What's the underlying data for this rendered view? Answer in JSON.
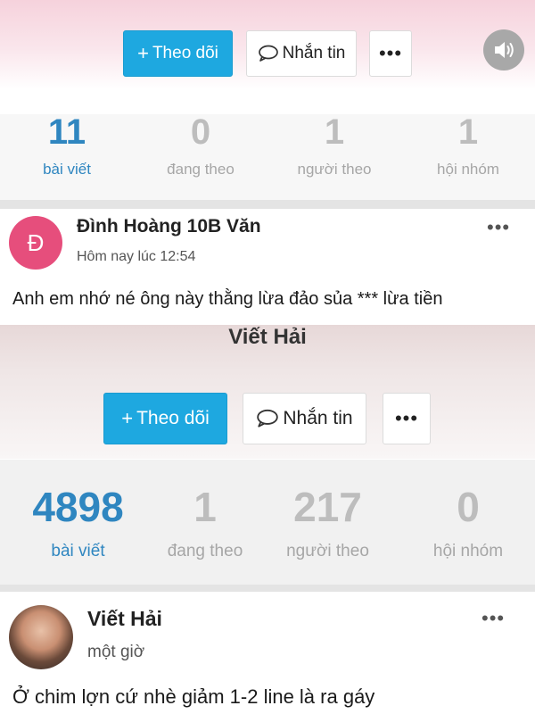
{
  "top_profile": {
    "follow_label": "+ Theo dõi",
    "follow_text": "Theo dõi",
    "message_label": "Nhắn tin",
    "more_label": "•••",
    "stats": [
      {
        "value": "11",
        "label": "bài viết"
      },
      {
        "value": "0",
        "label": "đang theo"
      },
      {
        "value": "1",
        "label": "người theo"
      },
      {
        "value": "1",
        "label": "hội nhóm"
      }
    ]
  },
  "post": {
    "author": "Đình Hoàng 10B Văn",
    "avatar_letter": "Đ",
    "time": "Hôm nay lúc 12:54",
    "more": "•••",
    "text": "Anh em nhớ né ông này thằng lừa đảo sủa *** lừa tiền"
  },
  "embedded_profile": {
    "name": "Viết Hải",
    "follow_text": "Theo dõi",
    "message_label": "Nhắn tin",
    "more_label": "•••",
    "stats": [
      {
        "value": "4898",
        "label": "bài viết"
      },
      {
        "value": "1",
        "label": "đang theo"
      },
      {
        "value": "217",
        "label": "người theo"
      },
      {
        "value": "0",
        "label": "hội nhóm"
      }
    ]
  },
  "embedded_post": {
    "author": "Viết Hải",
    "time": "một giờ",
    "more": "•••",
    "text": "Ở chim lợn cứ nhè giảm 1-2 line là ra gáy"
  },
  "colors": {
    "accent": "#1ea8e0",
    "active_stat": "#2f86c0",
    "avatar_d": "#e64e7c"
  },
  "icons": [
    "plus-icon",
    "chat-bubble-icon",
    "speaker-icon",
    "more-dots-icon"
  ]
}
